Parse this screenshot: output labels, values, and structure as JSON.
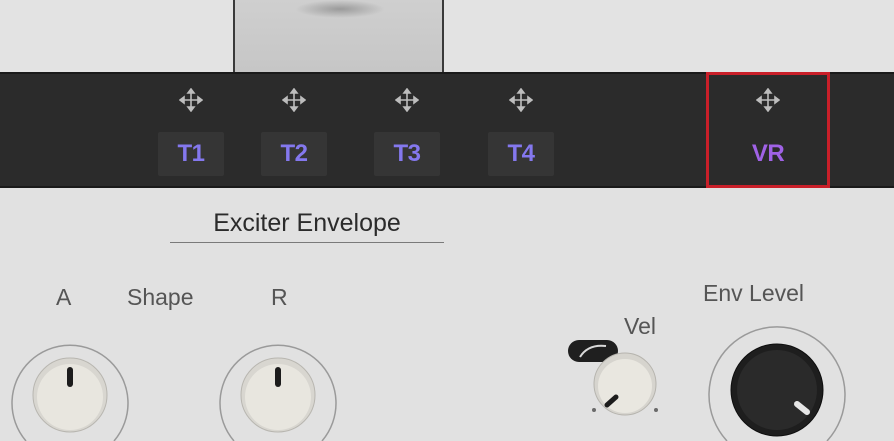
{
  "macros": {
    "items": [
      {
        "label": "T1"
      },
      {
        "label": "T2"
      },
      {
        "label": "T3"
      },
      {
        "label": "T4"
      },
      {
        "label": "VR"
      }
    ]
  },
  "envelope": {
    "title": "Exciter Envelope",
    "knobs": {
      "attack": "A",
      "shape": "Shape",
      "release": "R",
      "velocity": "Vel",
      "env_level": "Env Level"
    }
  },
  "colors": {
    "macro_label": "#8478ee",
    "vr_label": "#a062e6",
    "highlight_frame": "#c91f29"
  },
  "icons": {
    "macro_handle": "move-arrows-icon",
    "velocity_toggle": "velocity-curve-icon"
  }
}
